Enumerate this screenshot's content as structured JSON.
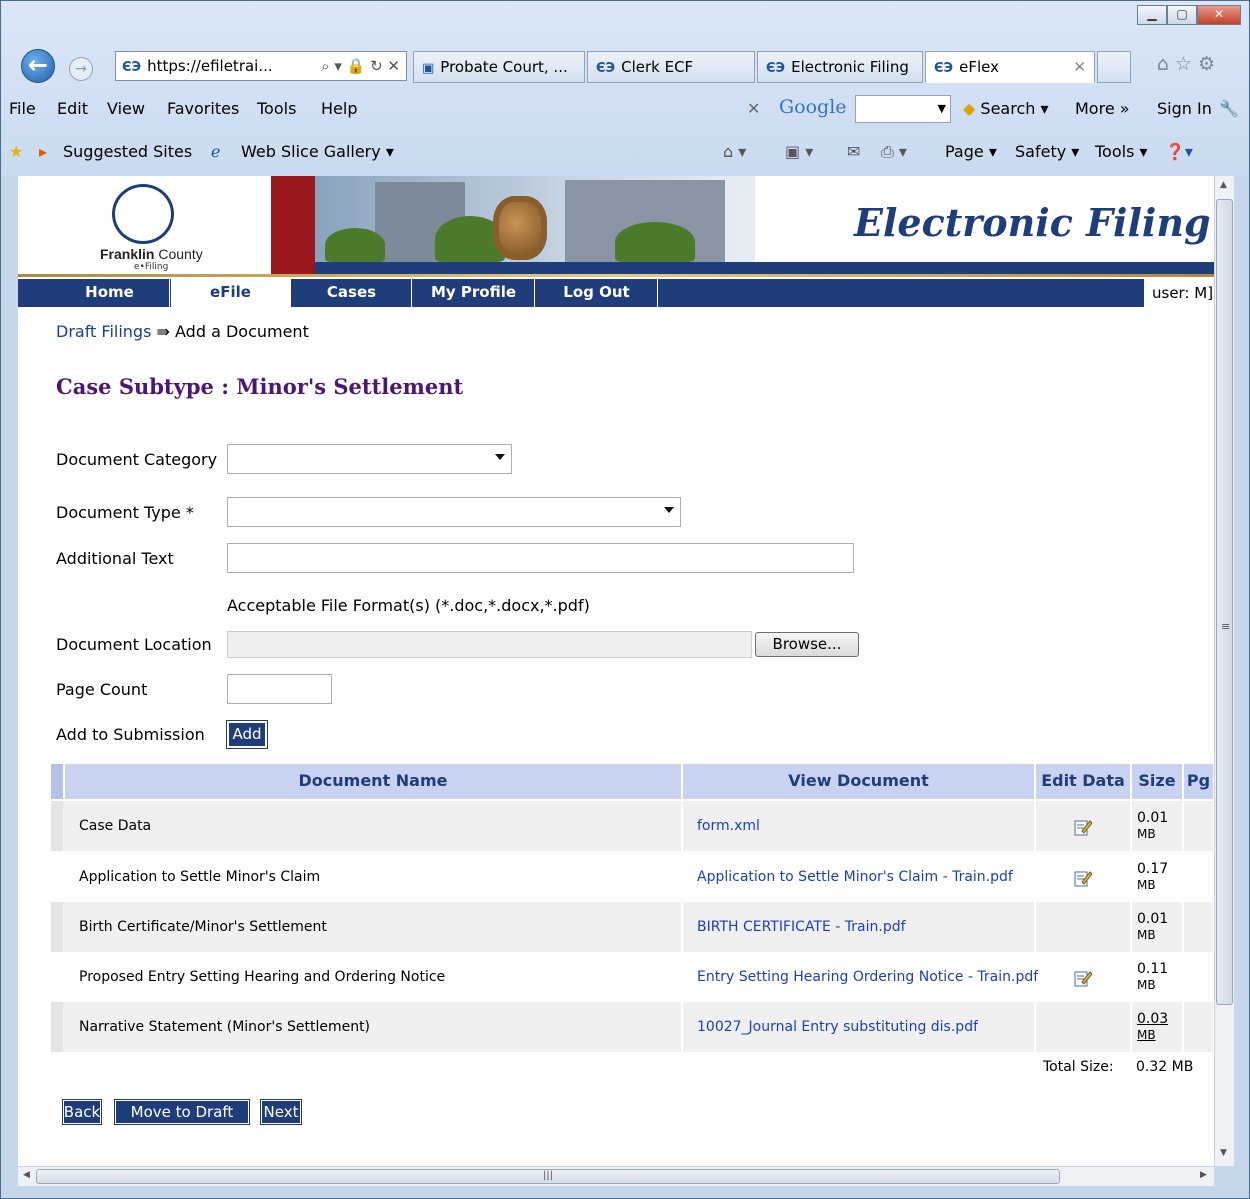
{
  "browser": {
    "address": "https://efiletrai...",
    "tabs": [
      "Probate Court, ...",
      "Clerk ECF",
      "Electronic Filing",
      "eFlex"
    ],
    "menu": [
      "File",
      "Edit",
      "View",
      "Favorites",
      "Tools",
      "Help"
    ],
    "toolbar_right": {
      "google": "Google",
      "search": "Search ▾",
      "more": "More »",
      "signin": "Sign In"
    },
    "favorites": {
      "suggested": "Suggested Sites",
      "webslice": "Web Slice Gallery ▾"
    },
    "cmd": {
      "page": "Page ▾",
      "safety": "Safety ▾",
      "tools": "Tools ▾"
    }
  },
  "site": {
    "logo_top": "Franklin",
    "logo_county": " County",
    "logo_sub": "e•Filing",
    "title": "Electronic Filing",
    "nav": [
      "Home",
      "eFile",
      "Cases",
      "My Profile",
      "Log Out"
    ],
    "user": "user: M]"
  },
  "breadcrumb": {
    "link": "Draft Filings",
    "sep": " ⇛ ",
    "current": "Add a Document"
  },
  "subtype": "Case Subtype : Minor's Settlement",
  "form": {
    "category_label": "Document Category",
    "type_label": "Document Type *",
    "additional_label": "Additional Text",
    "formats": "Acceptable File Format(s) (*.doc,*.docx,*.pdf)",
    "location_label": "Document Location",
    "browse": "Browse...",
    "page_count_label": "Page Count",
    "add_label": "Add to Submission",
    "add_button": "Add"
  },
  "table": {
    "headers": [
      "Document Name",
      "View Document",
      "Edit Data",
      "Size",
      "Pg"
    ],
    "rows": [
      {
        "name": "Case Data",
        "view": "form.xml",
        "edit": true,
        "size1": "0.01",
        "size2": "MB"
      },
      {
        "name": "Application to Settle Minor's Claim",
        "view": "Application to Settle Minor's Claim - Train.pdf",
        "edit": true,
        "size1": "0.17",
        "size2": "MB"
      },
      {
        "name": "Birth Certificate/Minor's Settlement",
        "view": "BIRTH CERTIFICATE - Train.pdf",
        "edit": false,
        "size1": "0.01",
        "size2": "MB"
      },
      {
        "name": "Proposed Entry Setting Hearing and Ordering Notice",
        "view": "Entry Setting Hearing Ordering Notice - Train.pdf",
        "edit": true,
        "size1": "0.11",
        "size2": "MB"
      },
      {
        "name": "Narrative Statement (Minor's Settlement)",
        "view": "10027_Journal Entry substituting dis.pdf",
        "edit": false,
        "size1": "0.03",
        "size2": "MB"
      }
    ],
    "total_label": "Total Size:",
    "total_value": "0.32 MB"
  },
  "buttons": {
    "back": "Back",
    "move": "Move to Draft",
    "next": "Next"
  },
  "colors": {
    "nav": "#1f3d7a",
    "subtype": "#4d1674",
    "header": "#c7d3f0",
    "link": "#1a3ec8",
    "red": "#99191c"
  }
}
